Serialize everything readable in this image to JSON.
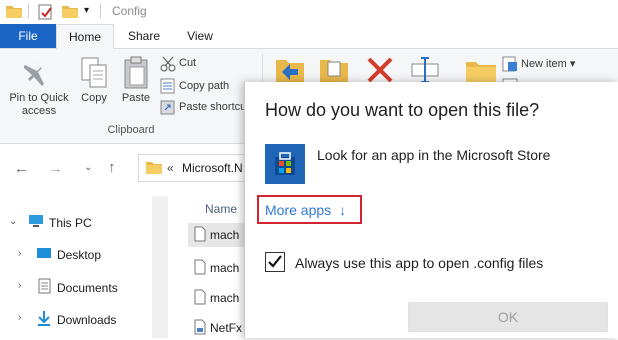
{
  "titlebar": {
    "title": "Config"
  },
  "tabs": {
    "file": "File",
    "home": "Home",
    "share": "Share",
    "view": "View"
  },
  "ribbon": {
    "pin_label_1": "Pin to Quick",
    "pin_label_2": "access",
    "copy_label": "Copy",
    "paste_label": "Paste",
    "cut_label": "Cut",
    "copy_path_label": "Copy path",
    "paste_shortcut_label": "Paste shortcut",
    "clipboard_group": "Clipboard",
    "new_item_label": "New item ▾"
  },
  "address": {
    "path": "Microsoft.N"
  },
  "navpane": {
    "items": [
      {
        "label": "This PC"
      },
      {
        "label": "Desktop"
      },
      {
        "label": "Documents"
      },
      {
        "label": "Downloads"
      }
    ]
  },
  "filelist": {
    "header_name": "Name",
    "rows": [
      "mach",
      "mach",
      "mach",
      "NetFx"
    ]
  },
  "dialog": {
    "title": "How do you want to open this file?",
    "store_option": "Look for an app in the Microsoft Store",
    "more_apps": "More apps",
    "always_use": "Always use this app to open .config files",
    "always_checked": true,
    "ok": "OK"
  },
  "colors": {
    "file_tab": "#1a64c4",
    "more_apps_link": "#2f7ad6",
    "highlight_border": "#d0252e",
    "store_icon_bg": "#1f66b7"
  }
}
